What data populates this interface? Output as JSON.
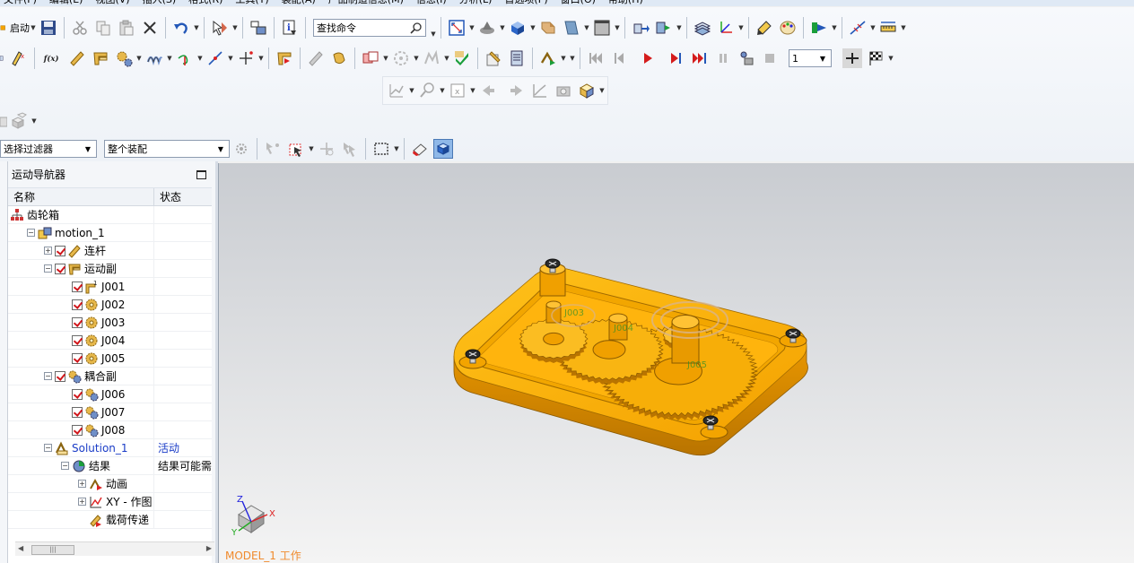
{
  "menubar": {
    "items": [
      "文件(F)",
      "编辑(E)",
      "视图(V)",
      "插入(S)",
      "格式(R)",
      "工具(T)",
      "装配(A)",
      "产品制造信息(M)",
      "信息(I)",
      "分析(L)",
      "首选项(P)",
      "窗口(O)",
      "帮助(H)"
    ]
  },
  "toolbar": {
    "start_label": "启动",
    "command_search_placeholder": "查找命令",
    "frame_value": "1"
  },
  "selection_bar": {
    "filter_value": "选择过滤器",
    "scope_value": "整个装配"
  },
  "navigator": {
    "title": "运动导航器",
    "columns": {
      "name": "名称",
      "status": "状态"
    },
    "rows": [
      {
        "label": "齿轮箱",
        "status": ""
      },
      {
        "label": "motion_1",
        "status": ""
      },
      {
        "label": "连杆",
        "status": ""
      },
      {
        "label": "运动副",
        "status": ""
      },
      {
        "label": "J001",
        "status": ""
      },
      {
        "label": "J002",
        "status": ""
      },
      {
        "label": "J003",
        "status": ""
      },
      {
        "label": "J004",
        "status": ""
      },
      {
        "label": "J005",
        "status": ""
      },
      {
        "label": "耦合副",
        "status": ""
      },
      {
        "label": "J006",
        "status": ""
      },
      {
        "label": "J007",
        "status": ""
      },
      {
        "label": "J008",
        "status": ""
      },
      {
        "label": "Solution_1",
        "status": "活动"
      },
      {
        "label": "结果",
        "status": "结果可能需"
      },
      {
        "label": "动画",
        "status": ""
      },
      {
        "label": "XY - 作图",
        "status": ""
      },
      {
        "label": "载荷传递",
        "status": ""
      }
    ]
  },
  "viewport": {
    "work_part": "MODEL_1 工作",
    "axis_labels": {
      "x": "X",
      "y": "Y",
      "z": "Z"
    },
    "joint_labels": [
      "J003",
      "J004",
      "J005"
    ]
  },
  "colors": {
    "part_orange": "#f5a300",
    "part_orange_dark": "#c97d00",
    "status_orange": "#f08a2c",
    "check_red": "#d0161b",
    "active_blue": "#1a3cc7"
  }
}
